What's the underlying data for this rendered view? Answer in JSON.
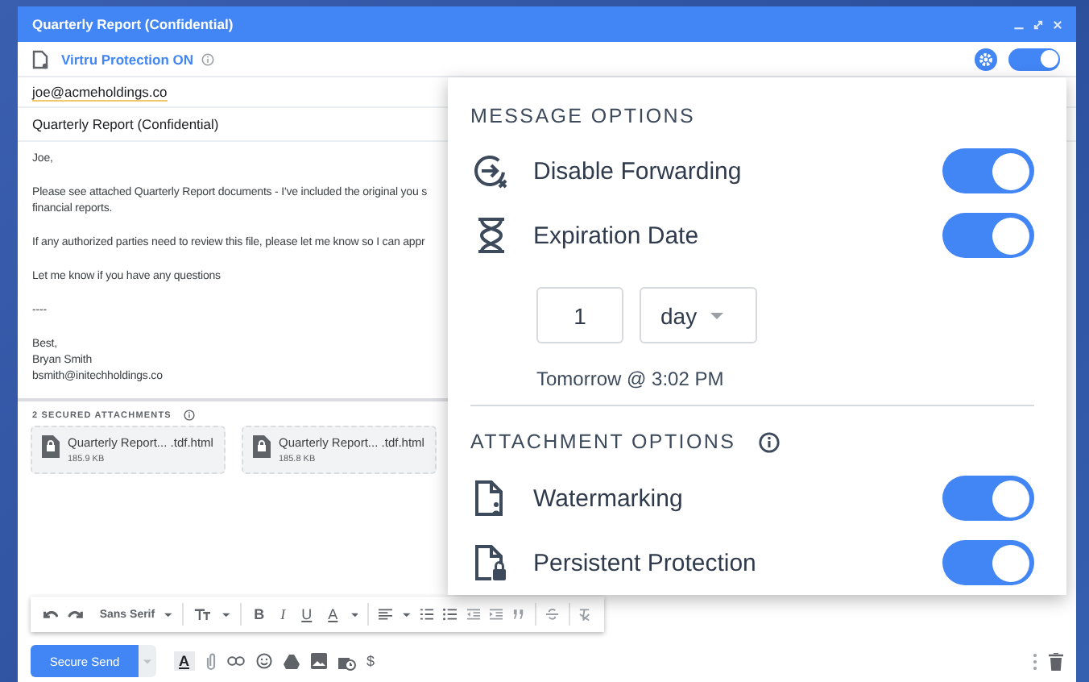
{
  "window": {
    "title": "Quarterly Report (Confidential)"
  },
  "protection_bar": {
    "label": "Virtru Protection ON",
    "on": true
  },
  "to": "joe@acmeholdings.co",
  "subject": "Quarterly Report (Confidential)",
  "body": {
    "paragraphs": [
      [
        "Joe,"
      ],
      [
        "Please see attached Quarterly Report documents - I've included the original you s",
        "financial reports."
      ],
      [
        "If any authorized parties need to review this file, please let me know so I can appr"
      ],
      [
        "Let me know if you have any questions"
      ],
      [
        "----"
      ],
      [
        "Best,",
        "Bryan Smith",
        "bsmith@initechholdings.co"
      ]
    ]
  },
  "attachments": {
    "label": "2 SECURED ATTACHMENTS",
    "files": [
      {
        "name": "Quarterly Report... .tdf.html",
        "size": "185.9 KB"
      },
      {
        "name": "Quarterly Report... .tdf.html",
        "size": "185.8 KB"
      }
    ]
  },
  "format_toolbar": {
    "font": "Sans Serif",
    "bold": "B",
    "italic": "I",
    "underline": "U",
    "text_color": "A"
  },
  "send_bar": {
    "send_button": "Secure Send",
    "format_glyph": "A",
    "currency_glyph": "$"
  },
  "options_panel": {
    "message_title": "MESSAGE OPTIONS",
    "message_options": [
      {
        "label": "Disable Forwarding",
        "on": true
      },
      {
        "label": "Expiration Date",
        "on": true
      }
    ],
    "expiry": {
      "amount": "1",
      "unit": "day",
      "summary": "Tomorrow @ 3:02 PM"
    },
    "attachment_title": "ATTACHMENT OPTIONS",
    "attachment_options": [
      {
        "label": "Watermarking",
        "on": true
      },
      {
        "label": "Persistent Protection",
        "on": true
      }
    ]
  }
}
